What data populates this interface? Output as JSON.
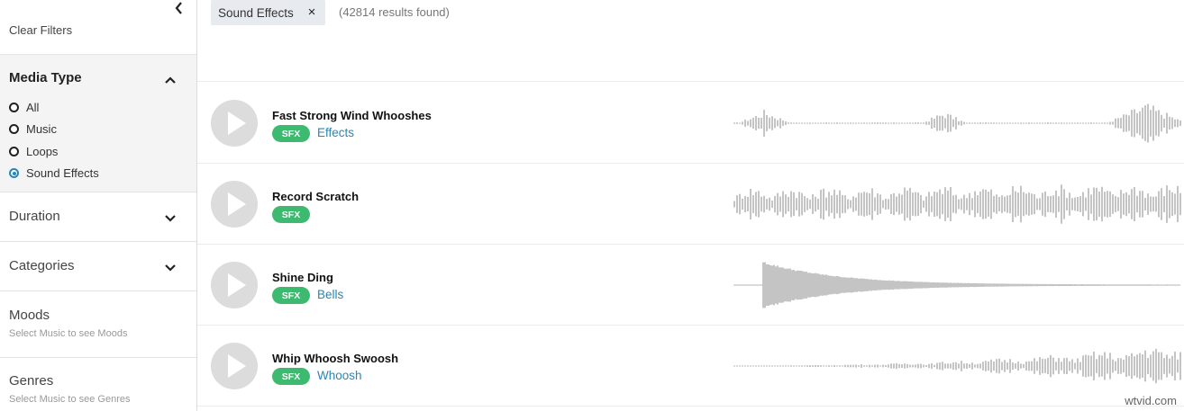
{
  "sidebar": {
    "clear_filters": "Clear Filters",
    "media_type": {
      "title": "Media Type",
      "options": [
        {
          "label": "All",
          "checked": false
        },
        {
          "label": "Music",
          "checked": false
        },
        {
          "label": "Loops",
          "checked": false
        },
        {
          "label": "Sound Effects",
          "checked": true
        }
      ]
    },
    "filters": [
      {
        "title": "Duration",
        "subtitle": ""
      },
      {
        "title": "Categories",
        "subtitle": ""
      },
      {
        "title": "Moods",
        "subtitle": "Select Music to see Moods"
      },
      {
        "title": "Genres",
        "subtitle": "Select Music to see Genres"
      }
    ]
  },
  "main": {
    "active_filter_chip": "Sound Effects",
    "chip_close_icon": "×",
    "results_text": "(42814 results found)",
    "tracks": [
      {
        "title": "Fast Strong Wind Whooshes",
        "badge": "SFX",
        "tag": "Effects"
      },
      {
        "title": "Record Scratch",
        "badge": "SFX",
        "tag": ""
      },
      {
        "title": "Shine Ding",
        "badge": "SFX",
        "tag": "Bells"
      },
      {
        "title": "Whip Whoosh Swoosh",
        "badge": "SFX",
        "tag": "Whoosh"
      }
    ]
  },
  "watermark": "wtvid.com",
  "colors": {
    "accent_blue": "#2a86b5",
    "sfx_green": "#3dba6f",
    "waveform_gray": "#8a8a8a",
    "play_button_gray": "#dcdcdc"
  }
}
